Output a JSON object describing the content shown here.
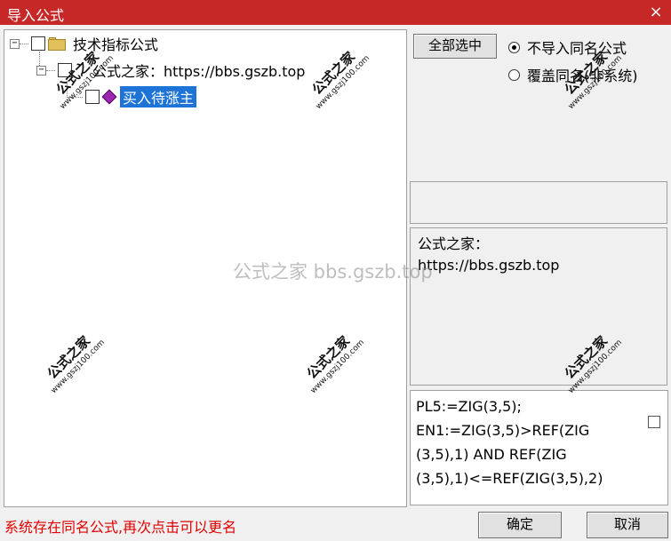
{
  "window": {
    "title": "导入公式",
    "close_icon": "×"
  },
  "tree": {
    "root": {
      "label": "技术指标公式",
      "expander": "−"
    },
    "group": {
      "label": "公式之家：https://bbs.gszb.top",
      "expander": "−"
    },
    "item": {
      "label": "买入待涨主"
    }
  },
  "options": {
    "select_all_label": "全部选中",
    "radio_skip_label": "不导入同名公式",
    "radio_overwrite_label": "覆盖同名(非系统)",
    "selected": "skip"
  },
  "info": {
    "line1": "公式之家：",
    "line2": "https://bbs.gszb.top"
  },
  "code": {
    "line1": "PL5:=ZIG(3,5);",
    "line2": "EN1:=ZIG(3,5)>REF(ZIG",
    "line3": "(3,5),1) AND REF(ZIG",
    "line4": "(3,5),1)<=REF(ZIG(3,5),2)"
  },
  "status": {
    "message": "系统存在同名公式,再次点击可以更名"
  },
  "buttons": {
    "ok_label": "确定",
    "cancel_label": "取消"
  },
  "watermark": {
    "center_text": "公式之家 bbs.gszb.top",
    "stamp_text": "公式之家",
    "stamp_url": "www.gszj100.com"
  },
  "colors": {
    "titlebar": "#c62828",
    "selection": "#1e74d6",
    "status_text": "#e00000"
  }
}
